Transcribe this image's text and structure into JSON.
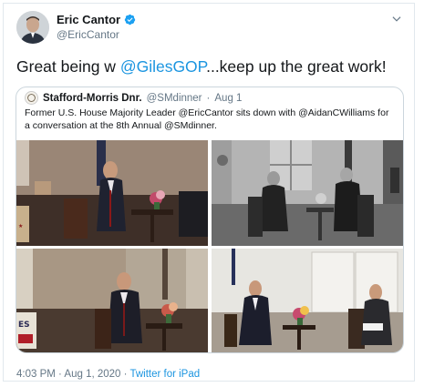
{
  "author": {
    "name": "Eric Cantor",
    "handle": "@EricCantor"
  },
  "tweet": {
    "text_before": "Great being w ",
    "mention": "@GilesGOP",
    "text_after": "...keep up the great work!"
  },
  "quoted": {
    "name": "Stafford-Morris Dnr.",
    "handle": "@SMdinner",
    "separator": "·",
    "date": "Aug 1",
    "text": "Former U.S. House Majority Leader @EricCantor sits down with @AidanCWilliams for a conversation at the 8th Annual @SMdinner.",
    "poster_letters": "ES"
  },
  "meta": {
    "time_date": "4:03 PM · Aug 1, 2020 · ",
    "source": "Twitter for iPad"
  },
  "colors": {
    "link": "#1b95e0",
    "secondary": "#657786",
    "border": "#e1e8ed"
  },
  "icons": {
    "verified": "verified-badge-icon",
    "menu": "chevron-down-icon"
  }
}
